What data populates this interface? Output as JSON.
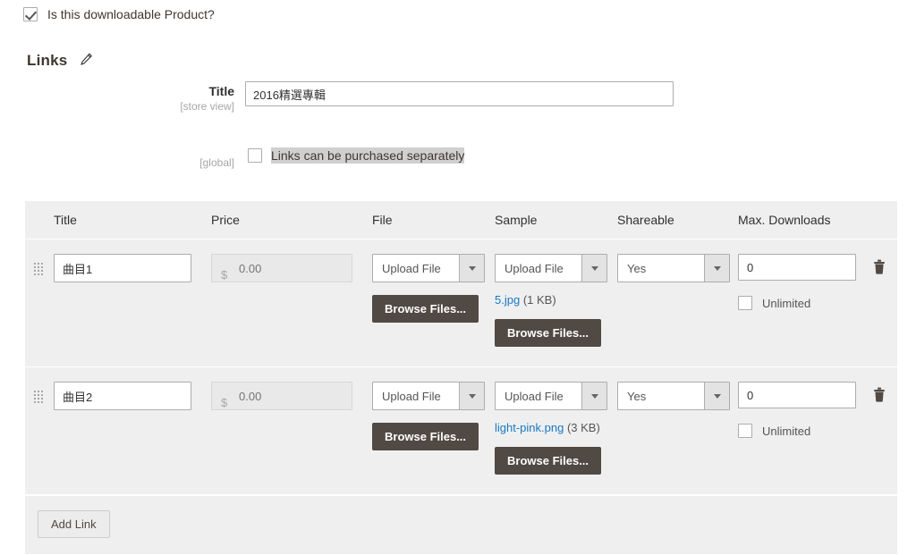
{
  "downloadable": {
    "label": "Is this downloadable Product?",
    "checked": true
  },
  "section": {
    "heading": "Links",
    "edit_icon": "pencil-icon"
  },
  "title_field": {
    "label": "Title",
    "scope": "[store view]",
    "value": "2016精選專輯",
    "placeholder": ""
  },
  "purchased_separately": {
    "scope": "[global]",
    "label": "Links can be purchased separately",
    "checked": false,
    "highlight_color": "#d0d0d0"
  },
  "table": {
    "columns": [
      "Title",
      "Price",
      "File",
      "Sample",
      "Shareable",
      "Max. Downloads"
    ],
    "rows": [
      {
        "title": "曲目1",
        "price": {
          "currency": "$",
          "placeholder": "0.00",
          "value": ""
        },
        "file": {
          "select_value": "Upload File",
          "browse_label": "Browse Files...",
          "uploaded": null
        },
        "sample": {
          "select_value": "Upload File",
          "browse_label": "Browse Files...",
          "uploaded": {
            "name": "5.jpg",
            "size": "(1 KB)"
          }
        },
        "shareable": "Yes",
        "max_downloads": {
          "value": "0",
          "unlimited_label": "Unlimited",
          "unlimited_checked": false
        },
        "delete_icon": "trash-icon"
      },
      {
        "title": "曲目2",
        "price": {
          "currency": "$",
          "placeholder": "0.00",
          "value": ""
        },
        "file": {
          "select_value": "Upload File",
          "browse_label": "Browse Files...",
          "uploaded": null
        },
        "sample": {
          "select_value": "Upload File",
          "browse_label": "Browse Files...",
          "uploaded": {
            "name": "light-pink.png",
            "size": "(3 KB)"
          }
        },
        "shareable": "Yes",
        "max_downloads": {
          "value": "0",
          "unlimited_label": "Unlimited",
          "unlimited_checked": false
        },
        "delete_icon": "trash-icon"
      }
    ],
    "add_link_label": "Add Link"
  },
  "colors": {
    "table_bg": "#efefef",
    "browse_button": "#514943",
    "link": "#1979c3",
    "text": "#41362f",
    "muted": "#a6a6a6"
  }
}
